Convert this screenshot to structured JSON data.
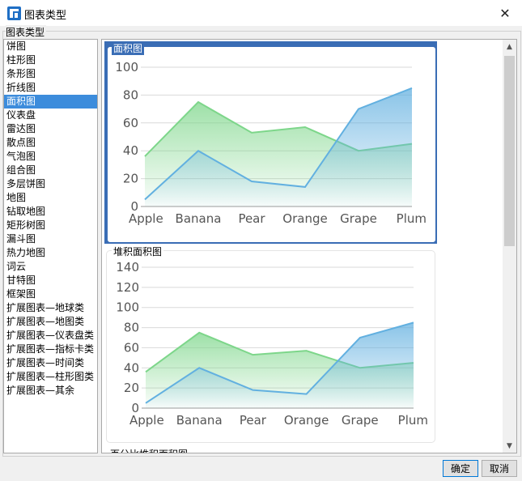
{
  "window": {
    "title": "图表类型",
    "close_glyph": "✕"
  },
  "group": {
    "label": "图表类型"
  },
  "type_list": {
    "selected_index": 4,
    "items": [
      "饼图",
      "柱形图",
      "条形图",
      "折线图",
      "面积图",
      "仪表盘",
      "雷达图",
      "散点图",
      "气泡图",
      "组合图",
      "多层饼图",
      "地图",
      "钻取地图",
      "矩形树图",
      "漏斗图",
      "热力地图",
      "词云",
      "甘特图",
      "框架图",
      "扩展图表—地球类",
      "扩展图表—地图类",
      "扩展图表—仪表盘类",
      "扩展图表—指标卡类",
      "扩展图表—时间类",
      "扩展图表—柱形图类",
      "扩展图表—其余"
    ]
  },
  "preview": {
    "cards": [
      {
        "title": "面积图",
        "selected": true
      },
      {
        "title": "堆积面积图",
        "selected": false
      },
      {
        "title": "百分比堆积面积图",
        "selected": false
      }
    ]
  },
  "colors": {
    "green": "#7dd68a",
    "blue": "#62b0e0",
    "selected": "#3c8cdc",
    "card_border": "#3a6db5"
  },
  "chart_data": [
    {
      "type": "area",
      "categories": [
        "Apple",
        "Banana",
        "Pear",
        "Orange",
        "Grape",
        "Plum"
      ],
      "yticks": [
        0,
        20,
        40,
        60,
        80,
        100
      ],
      "ylim": [
        0,
        100
      ],
      "grid": true,
      "series": [
        {
          "values": [
            36,
            75,
            53,
            57,
            40,
            45
          ]
        },
        {
          "values": [
            5,
            40,
            18,
            14,
            70,
            85
          ]
        }
      ]
    },
    {
      "type": "area",
      "categories": [
        "Apple",
        "Banana",
        "Pear",
        "Orange",
        "Grape",
        "Plum"
      ],
      "yticks": [
        0,
        20,
        40,
        60,
        80,
        100,
        120,
        140
      ],
      "ylim": [
        0,
        140
      ],
      "grid": true,
      "stacked": true,
      "series": [
        {
          "values": [
            36,
            75,
            53,
            57,
            40,
            45
          ]
        },
        {
          "values": [
            5,
            40,
            18,
            14,
            70,
            85
          ]
        }
      ]
    }
  ],
  "buttons": {
    "ok": "确定",
    "cancel": "取消"
  }
}
